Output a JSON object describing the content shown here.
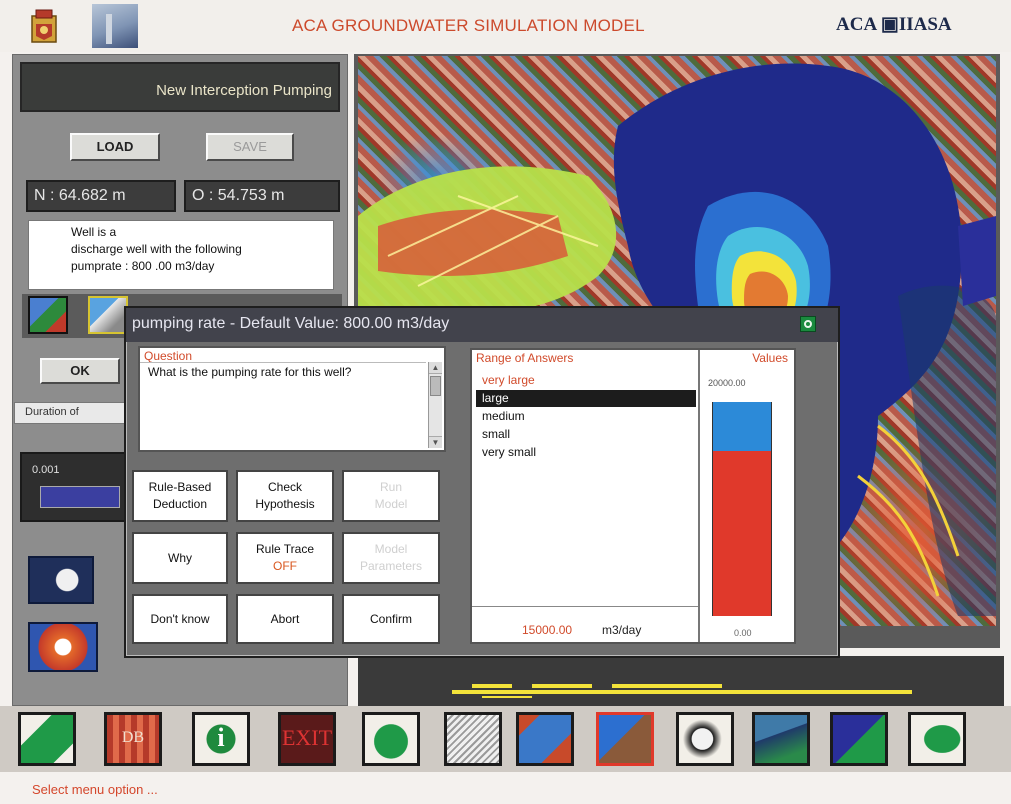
{
  "header": {
    "title": "ACA GROUNDWATER SIMULATION MODEL",
    "brand": "ACA ▣IIASA"
  },
  "well_panel": {
    "title": "New Interception Pumping",
    "load_label": "LOAD",
    "save_label": "SAVE",
    "coord_n": "N : 64.682  m",
    "coord_o": "O : 54.753  m",
    "info_line1": "Well is a",
    "info_line2": "discharge well with the following",
    "info_line3": "pumprate :   800 .00    m3/day",
    "ok_label": "OK",
    "duration_label": "Duration of",
    "concentration_value": "0.001"
  },
  "dialog": {
    "title": "pumping rate - Default Value: 800.00 m3/day",
    "question_label": "Question",
    "question_text": "What is the pumping rate for this well?",
    "buttons": {
      "rule_based_line1": "Rule-Based",
      "rule_based_line2": "Deduction",
      "check_line1": "Check",
      "check_line2": "Hypothesis",
      "run_line1": "Run",
      "run_line2": "Model",
      "why": "Why",
      "rule_trace_line1": "Rule Trace",
      "rule_trace_state": "OFF",
      "model_params_line1": "Model",
      "model_params_line2": "Parameters",
      "dont_know": "Don't know",
      "abort": "Abort",
      "confirm": "Confirm"
    },
    "answers_header": "Range of Answers",
    "values_header": "Values",
    "answers": [
      "very large",
      "large",
      "medium",
      "small",
      "very small"
    ],
    "selected_answer": "large",
    "answer_value": "15000.00",
    "answer_unit": "m3/day",
    "scale_max": "20000.00",
    "scale_min": "0.00",
    "scale_max_value": 20000,
    "scale_min_value": 0,
    "bar_value": 15000
  },
  "status": {
    "text": "Select menu option ..."
  },
  "colors": {
    "accent_orange": "#d14a2a",
    "bar_blue": "#2c8ad8",
    "bar_red": "#e0392b"
  },
  "toolbar": {
    "exit_label": "EXIT",
    "db_label": "DB"
  }
}
